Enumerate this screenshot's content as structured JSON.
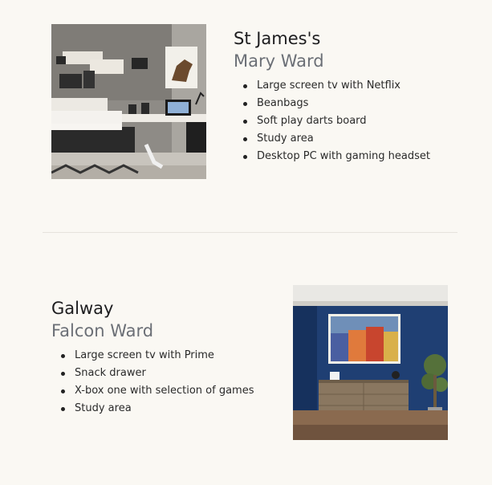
{
  "wards": [
    {
      "title": "St James's",
      "subtitle": "Mary Ward",
      "features": [
        "Large screen tv with Netflix",
        "Beanbags",
        "Soft play darts board",
        "Study area",
        "Desktop PC with gaming headset"
      ]
    },
    {
      "title": "Galway",
      "subtitle": "Falcon Ward",
      "features": [
        "Large screen tv with Prime",
        "Snack drawer",
        "X-box one with selection of games",
        "Study area"
      ]
    }
  ]
}
